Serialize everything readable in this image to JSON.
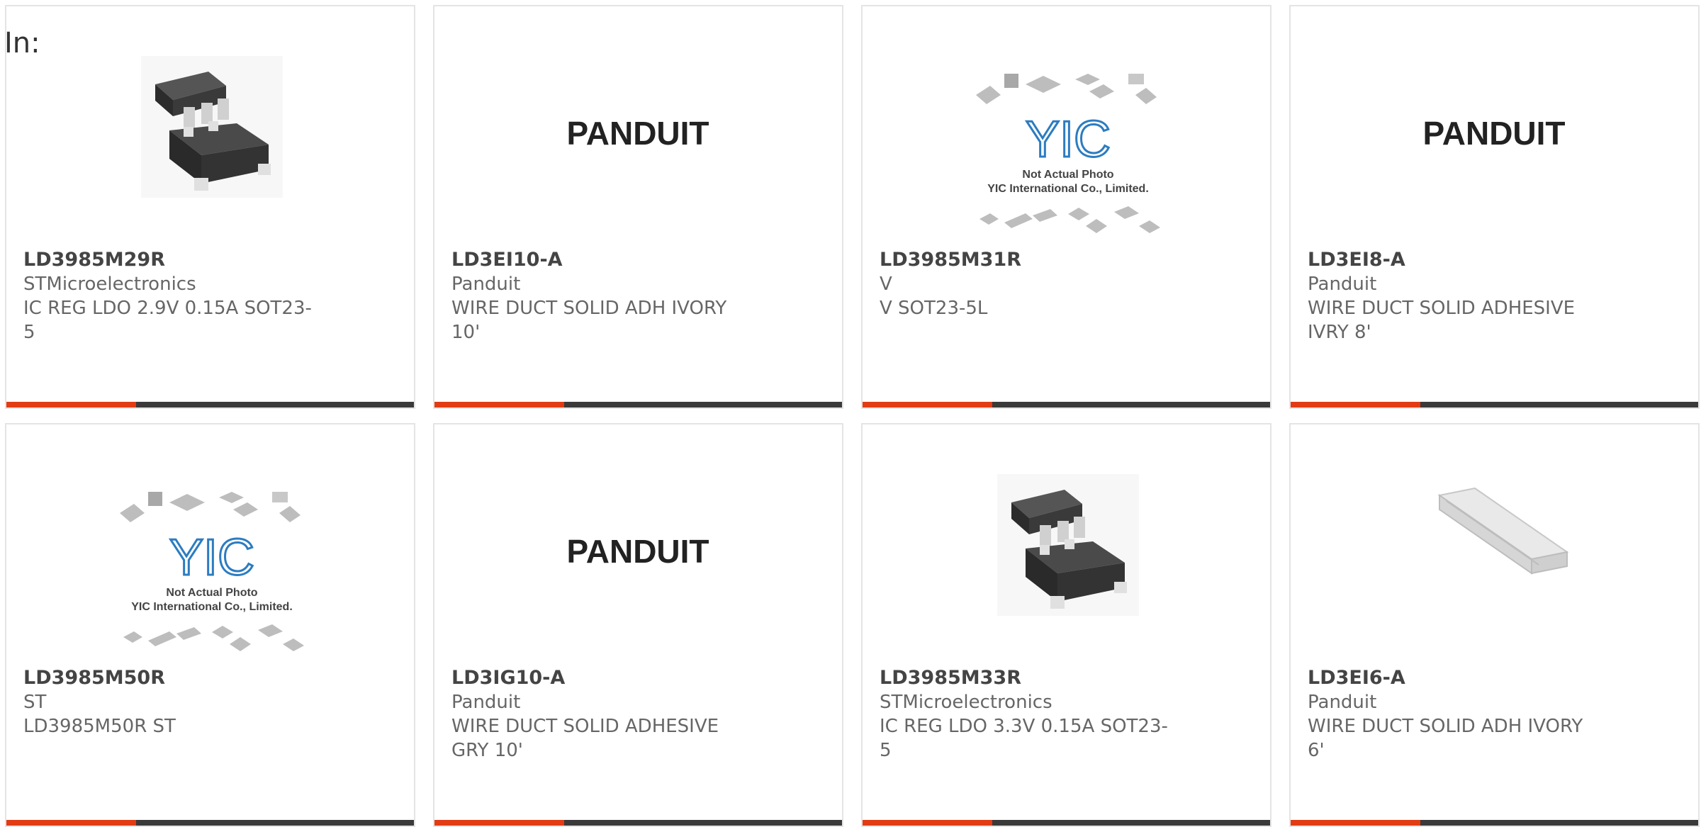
{
  "page": {
    "label": "In:"
  },
  "colors": {
    "accent": "#e23c14",
    "bar": "#3a3a3a",
    "text_dark": "#444444",
    "text_muted": "#666666"
  },
  "cards": [
    {
      "part": "LD3985M29R",
      "manufacturer": "STMicroelectronics",
      "description": "IC REG LDO 2.9V 0.15A SOT23-5",
      "image": "sot23-chip"
    },
    {
      "part": "LD3EI10-A",
      "manufacturer": "Panduit",
      "description": "WIRE DUCT SOLID ADH IVORY 10'",
      "image": "panduit-logo"
    },
    {
      "part": "LD3985M31R",
      "manufacturer": "V",
      "description": "V SOT23-5L",
      "image": "yic-placeholder"
    },
    {
      "part": "LD3EI8-A",
      "manufacturer": "Panduit",
      "description": "WIRE DUCT SOLID ADHESIVE IVRY 8'",
      "image": "panduit-logo"
    },
    {
      "part": "LD3985M50R",
      "manufacturer": "ST",
      "description": "LD3985M50R ST",
      "image": "yic-placeholder"
    },
    {
      "part": "LD3IG10-A",
      "manufacturer": "Panduit",
      "description": "WIRE DUCT SOLID ADHESIVE GRY 10'",
      "image": "panduit-logo"
    },
    {
      "part": "LD3985M33R",
      "manufacturer": "STMicroelectronics",
      "description": "IC REG LDO 3.3V 0.15A SOT23-5",
      "image": "sot23-chip"
    },
    {
      "part": "LD3EI6-A",
      "manufacturer": "Panduit",
      "description": "WIRE DUCT SOLID ADH IVORY 6'",
      "image": "wire-duct"
    }
  ],
  "logos": {
    "panduit": "PANDUIT",
    "yic_mark": "YIC",
    "yic_line1": "Not Actual Photo",
    "yic_line2": "YIC International Co., Limited."
  }
}
